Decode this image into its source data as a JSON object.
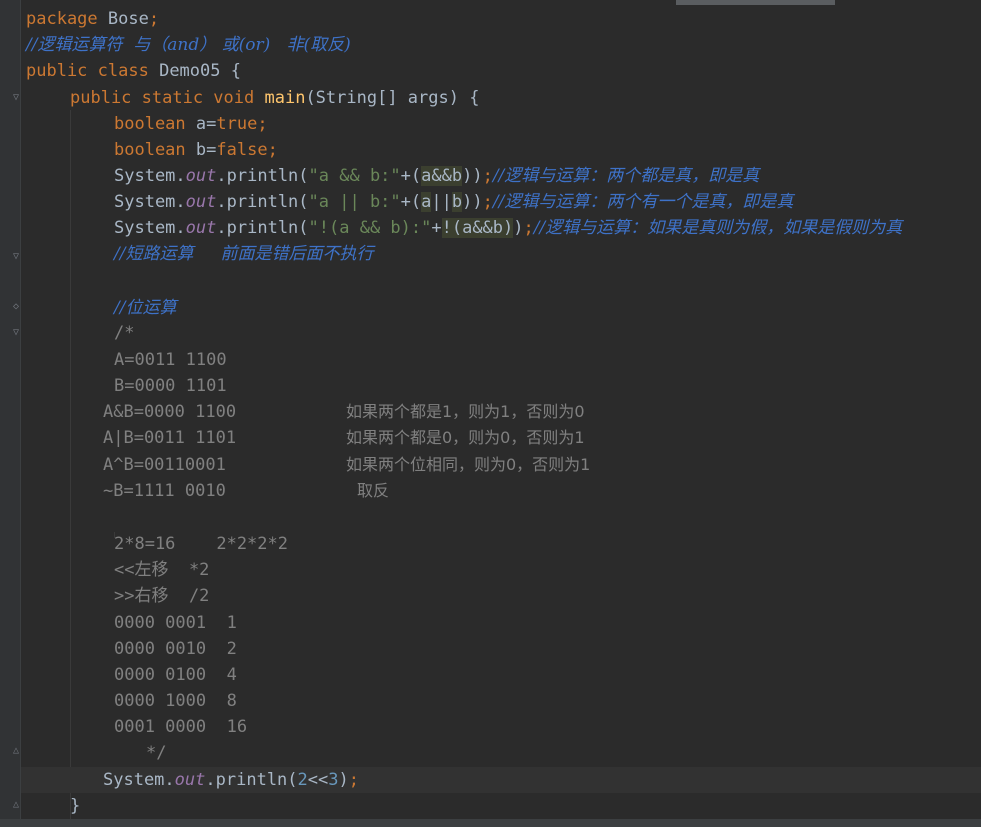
{
  "code": {
    "package_kw": "package",
    "package_name": "Bose",
    "semicolon": ";",
    "comment_logic": "//逻辑运算符  与（and） 或(or)   非(取反)",
    "class_kw": "public class",
    "class_name": "Demo05 {",
    "main_kw": "public static void",
    "main_name": "main",
    "main_args": "(String[] args) {",
    "bool_kw": "boolean",
    "a_decl": "a=",
    "true_kw": "true",
    "b_decl": "b=",
    "false_kw": "false",
    "system": "System",
    "dot": ".",
    "out": "out",
    "println": "println(",
    "str_and": "\"a && b:\"",
    "str_or": "\"a || b:\"",
    "str_not": "\"!(a && b):\"",
    "plus_open": "+(",
    "expr_and": "a&&b",
    "expr_or_a": "a",
    "expr_or_op": "||",
    "expr_or_b": "b",
    "plus_not": "+",
    "expr_not": "!(a&&b)",
    "close2": "))",
    "close1": ")",
    "comment_and": "//逻辑与运算：两个都是真，即是真",
    "comment_or": "//逻辑与运算：两个有一个是真，即是真",
    "comment_not": "//逻辑与运算：如果是真则为假，如果是假则为真",
    "comment_short": "//短路运算     前面是错后面不执行",
    "comment_bit": "//位运算",
    "block_open": "/*",
    "line_A": "A=0011 1100",
    "line_B": "B=0000 1101",
    "line_AandB": "A&B=0000 1100",
    "note_AandB": "如果两个都是1，则为1，否则为0",
    "line_AorB": "A|B=0011 1101",
    "note_AorB": "如果两个都是0，则为0，否则为1",
    "line_AxorB": "A^B=00110001",
    "note_AxorB": "如果两个位相同，则为0，否则为1",
    "line_notB": "~B=1111 0010",
    "note_notB": "取反",
    "line_2x8": "2*8=16    2*2*2*2",
    "line_left": "<<左移  *2",
    "line_right": ">>右移  /2",
    "bin1": "0000 0001  1",
    "bin2": "0000 0010  2",
    "bin4": "0000 0100  4",
    "bin8": "0000 1000  8",
    "bin16": "0001 0000  16",
    "block_close": "*/",
    "shift_num1": "2",
    "shift_op": "<<",
    "shift_num2": "3",
    "close_brace": "}"
  },
  "colors": {
    "background": "#2b2b2b",
    "keyword": "#cc7832",
    "string": "#6a8759",
    "comment": "#3e72c8",
    "method": "#ffc66d",
    "number": "#6897bb",
    "field": "#9876aa"
  }
}
